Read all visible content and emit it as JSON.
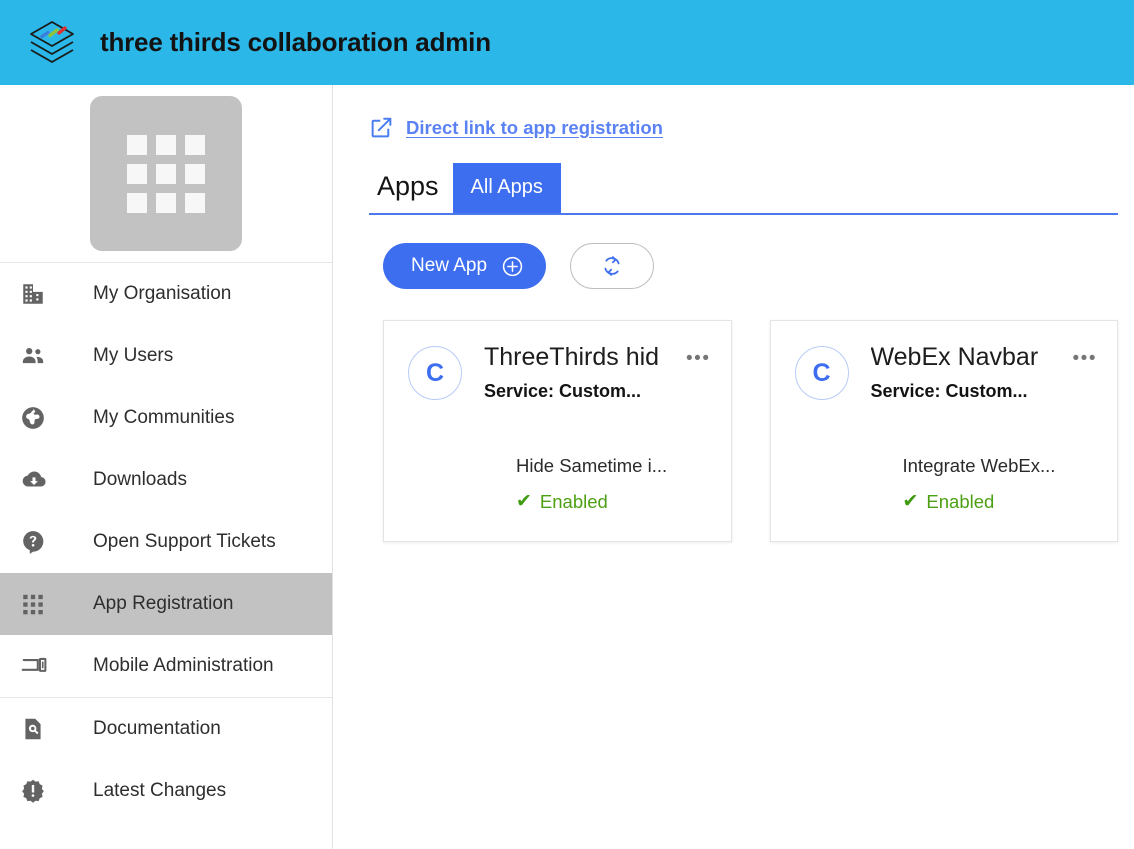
{
  "header": {
    "title": "three thirds collaboration admin",
    "logo_icon": "layers-stack-icon",
    "background_color": "#2bb8e8"
  },
  "sidebar": {
    "logo_tile_icon": "apps-grid-icon",
    "groups": [
      {
        "items": [
          {
            "label": "My Organisation",
            "icon": "building-icon",
            "active": false
          },
          {
            "label": "My Users",
            "icon": "people-icon",
            "active": false
          },
          {
            "label": "My Communities",
            "icon": "globe-icon",
            "active": false
          },
          {
            "label": "Downloads",
            "icon": "cloud-download-icon",
            "active": false
          },
          {
            "label": "Open Support Tickets",
            "icon": "help-question-icon",
            "active": false
          },
          {
            "label": "App Registration",
            "icon": "apps-grid-icon",
            "active": true
          },
          {
            "label": "Mobile Administration",
            "icon": "devices-icon",
            "active": false
          }
        ]
      },
      {
        "items": [
          {
            "label": "Documentation",
            "icon": "document-search-icon",
            "active": false
          },
          {
            "label": "Latest Changes",
            "icon": "alert-badge-icon",
            "active": false
          }
        ]
      }
    ]
  },
  "main": {
    "direct_link": {
      "label": "Direct link to app registration",
      "icon": "open-in-new-icon",
      "color": "#5b82f3"
    },
    "tabs_heading": "Apps",
    "tabs": [
      {
        "label": "All Apps",
        "active": true
      }
    ],
    "actions": {
      "new_app_label": "New App",
      "new_app_icon": "plus-circle-icon",
      "refresh_icon": "refresh-icon"
    },
    "cards": [
      {
        "avatar_letter": "C",
        "title": "ThreeThirds hid",
        "service": "Service: Custom...",
        "description": "Hide Sametime i...",
        "status": "Enabled",
        "status_icon": "check-icon",
        "menu_icon": "more-options-icon"
      },
      {
        "avatar_letter": "C",
        "title": "WebEx Navbar",
        "service": "Service: Custom...",
        "description": "Integrate WebEx...",
        "status": "Enabled",
        "status_icon": "check-icon",
        "menu_icon": "more-options-icon"
      }
    ]
  },
  "colors": {
    "header": "#2bb8e8",
    "accent_blue": "#3d6ef0",
    "active_nav": "#c2c2c2",
    "status_green": "#4da013"
  }
}
